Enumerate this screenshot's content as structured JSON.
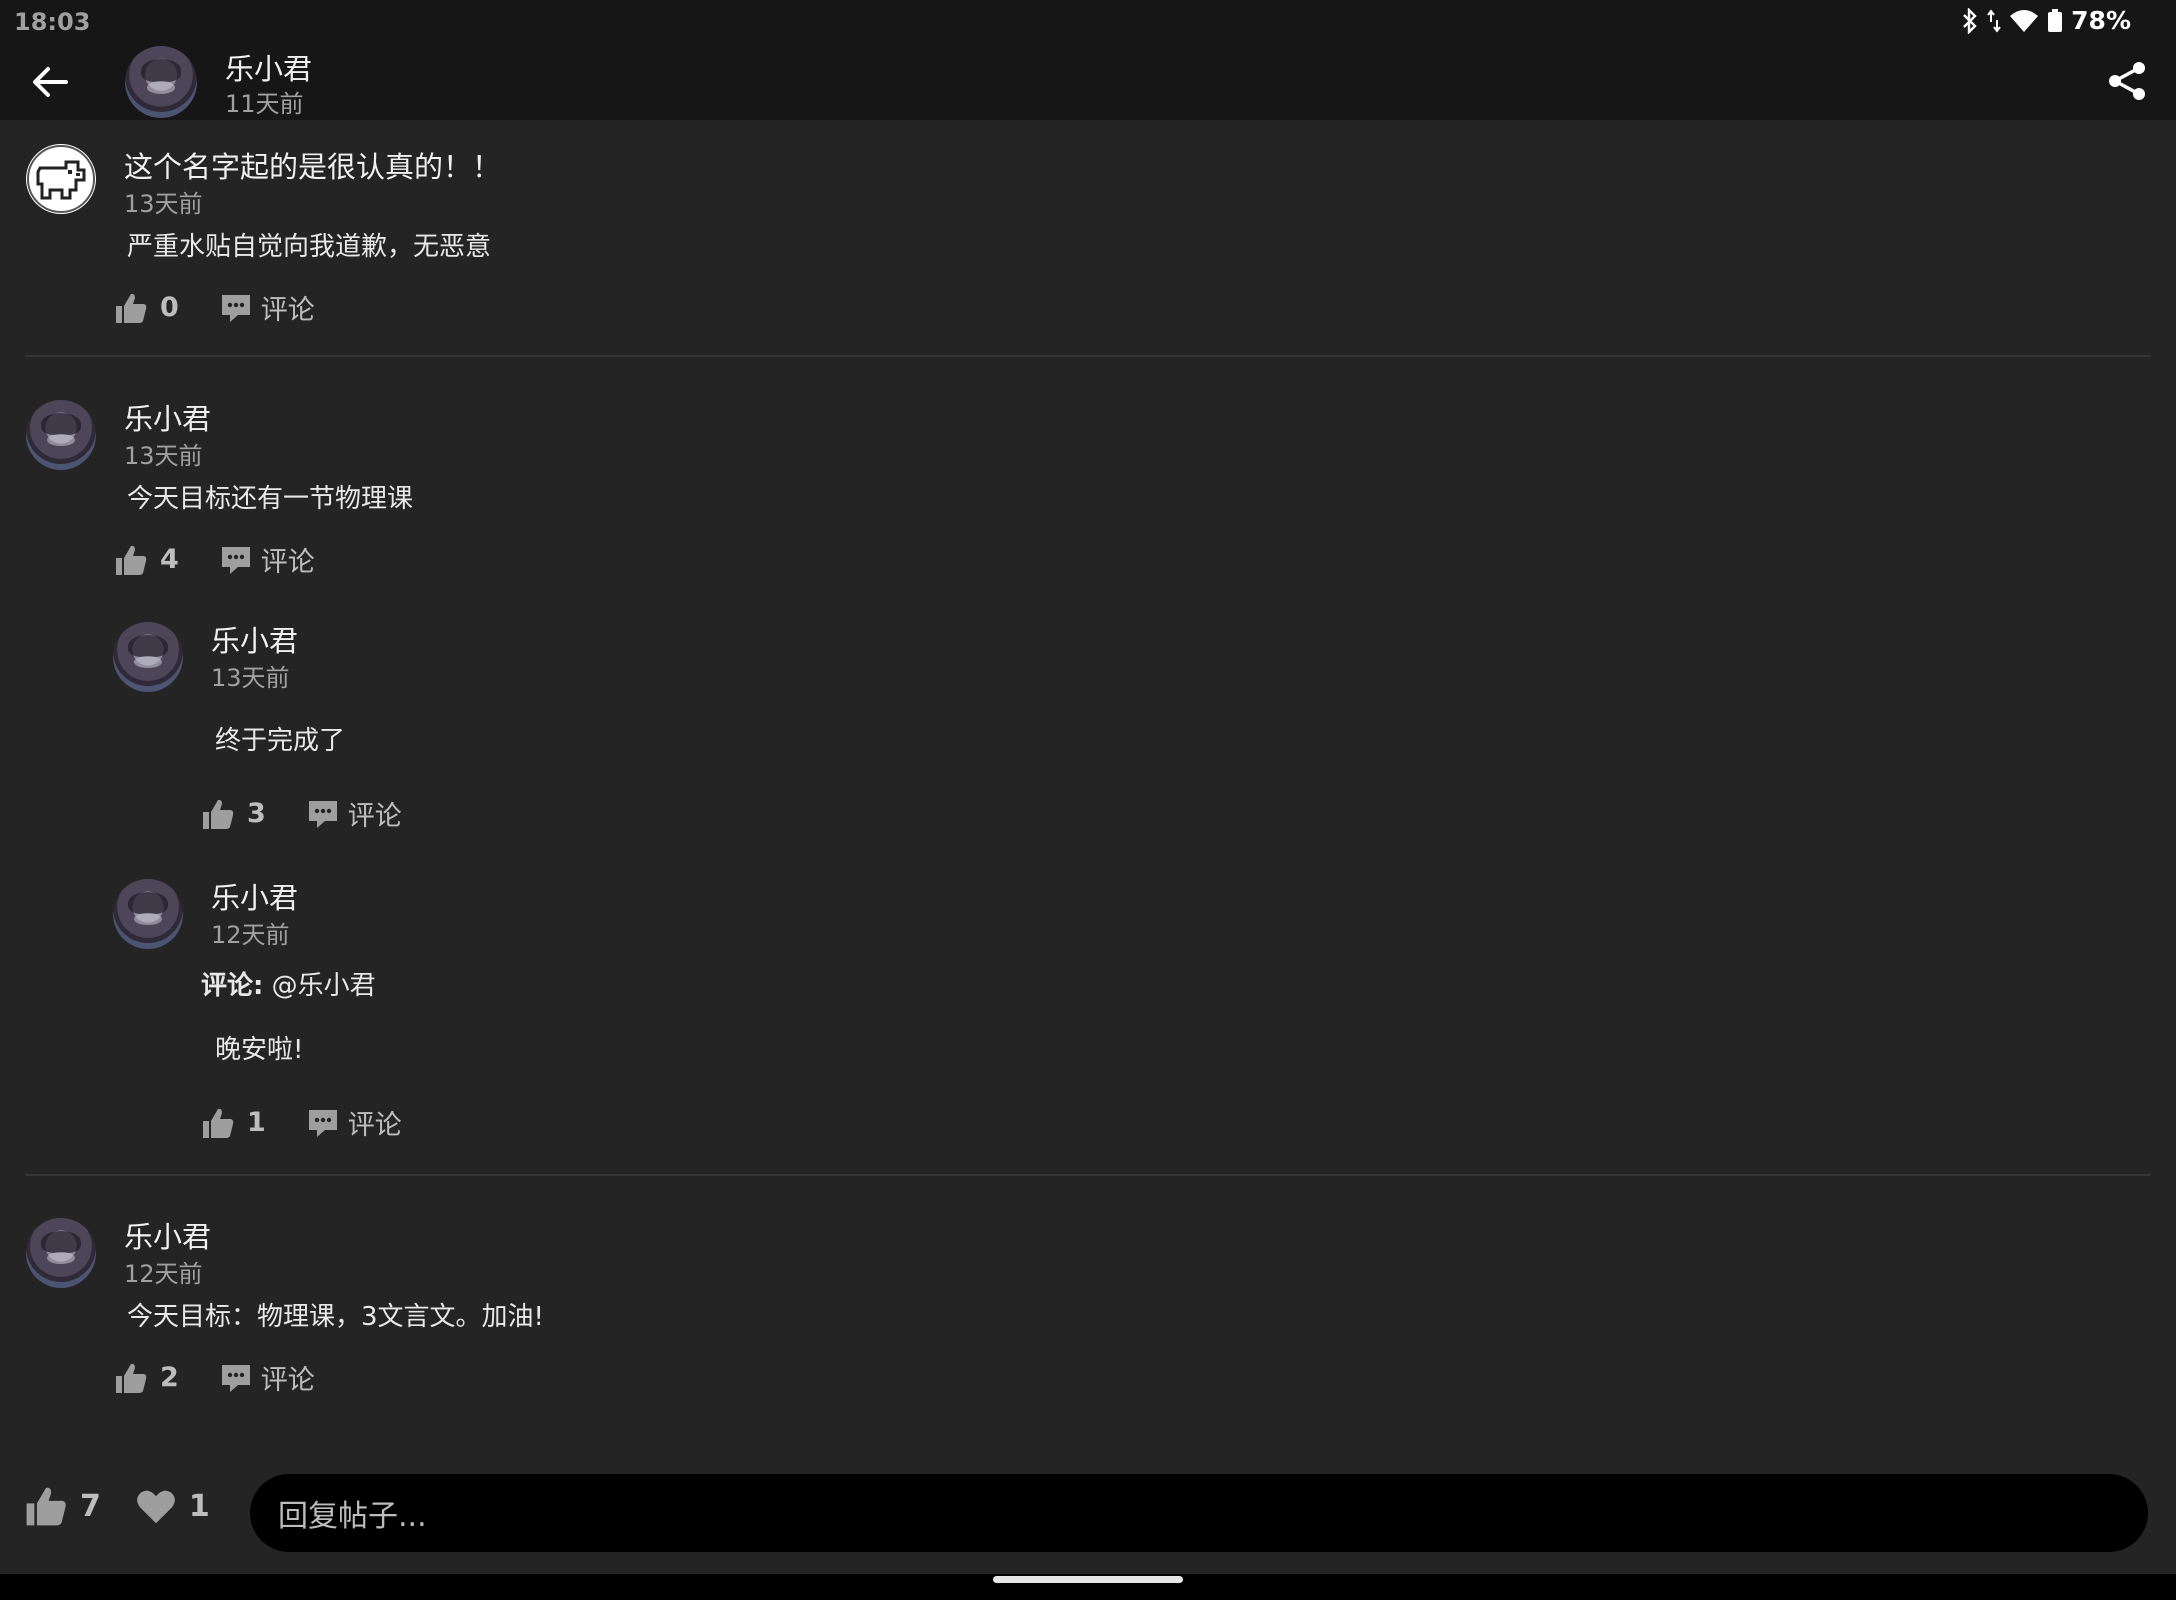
{
  "status_bar": {
    "time": "18:03",
    "battery": "78%"
  },
  "header": {
    "author": "乐小君",
    "time": "11天前"
  },
  "posts": [
    {
      "author": "这个名字起的是很认真的！！",
      "time": "13天前",
      "content": "严重水贴自觉向我道歉，无恶意",
      "likes": "0",
      "comment_label": "评论"
    },
    {
      "author": "乐小君",
      "time": "13天前",
      "content": "今天目标还有一节物理课",
      "likes": "4",
      "comment_label": "评论"
    },
    {
      "author": "乐小君",
      "time": "12天前",
      "content": "今天目标：物理课，3文言文。加油!",
      "likes": "2",
      "comment_label": "评论"
    }
  ],
  "replies": [
    {
      "author": "乐小君",
      "time": "13天前",
      "content": "终于完成了",
      "likes": "3",
      "comment_label": "评论"
    },
    {
      "author": "乐小君",
      "time": "12天前",
      "quote_label": "评论:",
      "quote_target": "@乐小君",
      "content": "晚安啦!",
      "likes": "1",
      "comment_label": "评论"
    }
  ],
  "bottom_bar": {
    "likes": "7",
    "favorites": "1",
    "reply_placeholder": "回复帖子..."
  }
}
